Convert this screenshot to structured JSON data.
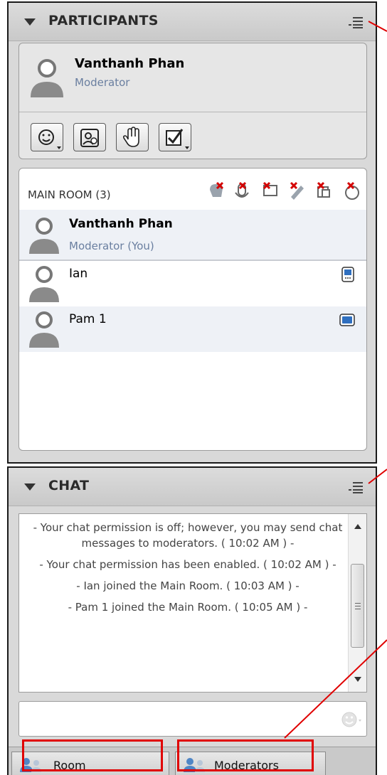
{
  "participants": {
    "title": "PARTICIPANTS",
    "me": {
      "name": "Vanthanh Phan",
      "role": "Moderator"
    },
    "tools": [
      "emoticon-dropdown-icon",
      "profile-icon",
      "raise-hand-icon",
      "checkbox-dropdown-icon"
    ],
    "room_label": "MAIN ROOM (3)",
    "members": [
      {
        "name": "Vanthanh Phan",
        "role": "Moderator (You)",
        "device": ""
      },
      {
        "name": "Ian",
        "role": "",
        "device": "mobile-device-icon"
      },
      {
        "name": "Pam 1",
        "role": "",
        "device": "desktop-device-icon"
      }
    ]
  },
  "chat": {
    "title": "CHAT",
    "messages": [
      "- Your chat permission is off; however, you may send chat messages to moderators. ( 10:02 AM ) -",
      "- Your chat permission has been enabled. ( 10:02 AM ) -",
      "- Ian joined the Main Room. ( 10:03 AM ) -",
      "- Pam 1 joined the Main Room. ( 10:05 AM ) -"
    ],
    "input_value": "",
    "tabs": [
      "Room",
      "Moderators"
    ]
  },
  "colors": {
    "accent_annotation": "#e00000",
    "role_text": "#6a7fa0",
    "panel_bg": "#d9d9d9"
  }
}
